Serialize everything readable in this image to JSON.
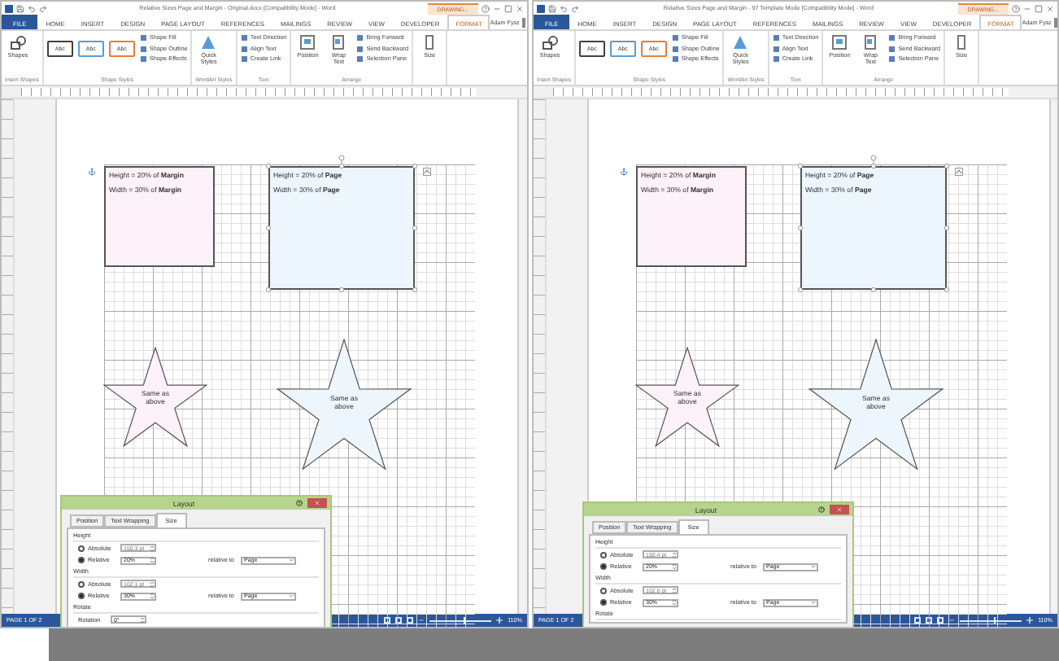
{
  "windows": [
    {
      "title_bar": {
        "title": "Relative Sizes Page and Margin - Original.docx [Compatibility Mode] - Word",
        "context_tab": "DRAWING..."
      },
      "menu_tabs": [
        {
          "label": "FILE",
          "kind": "file",
          "selected": false
        },
        {
          "label": "HOME",
          "kind": "tab",
          "selected": false
        },
        {
          "label": "INSERT",
          "kind": "tab",
          "selected": false
        },
        {
          "label": "DESIGN",
          "kind": "tab",
          "selected": false
        },
        {
          "label": "PAGE LAYOUT",
          "kind": "tab",
          "selected": false
        },
        {
          "label": "REFERENCES",
          "kind": "tab",
          "selected": false
        },
        {
          "label": "MAILINGS",
          "kind": "tab",
          "selected": false
        },
        {
          "label": "REVIEW",
          "kind": "tab",
          "selected": false
        },
        {
          "label": "VIEW",
          "kind": "tab",
          "selected": false
        },
        {
          "label": "DEVELOPER",
          "kind": "tab",
          "selected": false
        },
        {
          "label": "FORMAT",
          "kind": "context",
          "selected": true
        }
      ],
      "user": "Adam Fysz",
      "ribbon": [
        {
          "label": "Insert Shapes",
          "commands": [
            {
              "kind": "large",
              "label": "Shapes"
            }
          ]
        },
        {
          "label": "Shape Styles",
          "commands": [
            {
              "kind": "style",
              "label": "Abc",
              "color": "#404040"
            },
            {
              "kind": "style",
              "label": "Abc",
              "color": "#5b9bd5"
            },
            {
              "kind": "style",
              "label": "Abc",
              "color": "#ed7d31"
            },
            {
              "kind": "small",
              "label": "Shape Fill"
            },
            {
              "kind": "small",
              "label": "Shape Outline"
            },
            {
              "kind": "small",
              "label": "Shape Effects"
            }
          ]
        },
        {
          "label": "WordArt Styles",
          "commands": [
            {
              "kind": "large",
              "label": "Quick Styles"
            }
          ]
        },
        {
          "label": "Text",
          "commands": [
            {
              "kind": "small",
              "label": "Text Direction"
            },
            {
              "kind": "small",
              "label": "Align Text"
            },
            {
              "kind": "small",
              "label": "Create Link"
            }
          ]
        },
        {
          "label": "Arrange",
          "commands": [
            {
              "kind": "large",
              "label": "Position"
            },
            {
              "kind": "large",
              "label": "Wrap Text"
            },
            {
              "kind": "small",
              "label": "Bring Forward"
            },
            {
              "kind": "small",
              "label": "Send Backward"
            },
            {
              "kind": "small",
              "label": "Selection Pane"
            }
          ]
        },
        {
          "commands": [
            {
              "kind": "large",
              "label": "Size"
            }
          ]
        }
      ],
      "shapes": [
        {
          "kind": "rect",
          "color": "#fdf1fa",
          "selected": false,
          "lines": [
            "Height = 20% of **Margin**",
            "Width = 30% of **Margin**"
          ]
        },
        {
          "kind": "rect",
          "color": "#edf6fd",
          "selected": true,
          "lines": [
            "Height = 20% of **Page**",
            "Width = 30% of **Page**"
          ]
        },
        {
          "kind": "star",
          "color": "#fdf1fa",
          "text": "Same as above"
        },
        {
          "kind": "star",
          "color": "#edf6fd",
          "text": "Same as above"
        }
      ],
      "dialog": {
        "title": "Layout",
        "tabs": [
          {
            "label": "Position",
            "selected": false
          },
          {
            "label": "Text Wrapping",
            "selected": false
          },
          {
            "label": "Size",
            "selected": true
          }
        ],
        "sections": [
          {
            "heading": "Height",
            "rows": [
              {
                "kind": "radio",
                "label": "Absolute",
                "selected": false,
                "value": "150.3 pt"
              },
              {
                "kind": "radio",
                "label": "Relative",
                "selected": true,
                "value": "20%",
                "relative_label": "relative to",
                "relative_value": "Page"
              }
            ]
          },
          {
            "heading": "Width",
            "rows": [
              {
                "kind": "radio",
                "label": "Absolute",
                "selected": false,
                "value": "102.1 pt"
              },
              {
                "kind": "radio",
                "label": "Relative",
                "selected": true,
                "value": "30%",
                "relative_label": "relative to",
                "relative_value": "Page"
              }
            ]
          },
          {
            "heading": "Rotate",
            "rows": [
              {
                "kind": "spinner",
                "label": "Rotation",
                "value": "0°"
              }
            ]
          }
        ]
      },
      "status_bar": {
        "page": "PAGE 1 OF 2",
        "zoom_slider": {
          "level": 0.55
        },
        "zoom": "110%"
      }
    },
    {
      "title_bar": {
        "title": "Relative Sizes Page and Margin - 97 Template Mode [Compatibility Mode] - Word",
        "context_tab": "DRAWING..."
      },
      "menu_tabs": [
        {
          "label": "FILE",
          "kind": "file",
          "selected": false
        },
        {
          "label": "HOME",
          "kind": "tab",
          "selected": false
        },
        {
          "label": "INSERT",
          "kind": "tab",
          "selected": false
        },
        {
          "label": "DESIGN",
          "kind": "tab",
          "selected": false
        },
        {
          "label": "PAGE LAYOUT",
          "kind": "tab",
          "selected": false
        },
        {
          "label": "REFERENCES",
          "kind": "tab",
          "selected": false
        },
        {
          "label": "MAILINGS",
          "kind": "tab",
          "selected": false
        },
        {
          "label": "REVIEW",
          "kind": "tab",
          "selected": false
        },
        {
          "label": "VIEW",
          "kind": "tab",
          "selected": false
        },
        {
          "label": "DEVELOPER",
          "kind": "tab",
          "selected": false
        },
        {
          "label": "FORMAT",
          "kind": "context",
          "selected": true
        }
      ],
      "user": "Adam Fysz",
      "ribbon": [
        {
          "label": "Insert Shapes",
          "commands": [
            {
              "kind": "large",
              "label": "Shapes"
            }
          ]
        },
        {
          "label": "Shape Styles",
          "commands": [
            {
              "kind": "style",
              "label": "Abc",
              "color": "#404040"
            },
            {
              "kind": "style",
              "label": "Abc",
              "color": "#5b9bd5"
            },
            {
              "kind": "style",
              "label": "Abc",
              "color": "#ed7d31"
            },
            {
              "kind": "small",
              "label": "Shape Fill"
            },
            {
              "kind": "small",
              "label": "Shape Outline"
            },
            {
              "kind": "small",
              "label": "Shape Effects"
            }
          ]
        },
        {
          "label": "WordArt Styles",
          "commands": [
            {
              "kind": "large",
              "label": "Quick Styles"
            }
          ]
        },
        {
          "label": "Text",
          "commands": [
            {
              "kind": "small",
              "label": "Text Direction"
            },
            {
              "kind": "small",
              "label": "Align Text"
            },
            {
              "kind": "small",
              "label": "Create Link"
            }
          ]
        },
        {
          "label": "Arrange",
          "commands": [
            {
              "kind": "large",
              "label": "Position"
            },
            {
              "kind": "large",
              "label": "Wrap Text"
            },
            {
              "kind": "small",
              "label": "Bring Forward"
            },
            {
              "kind": "small",
              "label": "Send Backward"
            },
            {
              "kind": "small",
              "label": "Selection Pane"
            }
          ]
        },
        {
          "commands": [
            {
              "kind": "large",
              "label": "Size"
            }
          ]
        }
      ],
      "shapes": [
        {
          "kind": "rect",
          "color": "#fdf1fa",
          "selected": false,
          "lines": [
            "Height = 20% of **Margin**",
            "Width = 30% of **Margin**"
          ]
        },
        {
          "kind": "rect",
          "color": "#edf6fd",
          "selected": true,
          "lines": [
            "Height = 20% of **Page**",
            "Width = 30% of **Page**"
          ]
        },
        {
          "kind": "star",
          "color": "#fdf1fa",
          "text": "Same as above"
        },
        {
          "kind": "star",
          "color": "#edf6fd",
          "text": "Same as above"
        }
      ],
      "dialog": {
        "title": "Layout",
        "tabs": [
          {
            "label": "Position",
            "selected": false
          },
          {
            "label": "Text Wrapping",
            "selected": false
          },
          {
            "label": "Size",
            "selected": true
          }
        ],
        "sections": [
          {
            "heading": "Height",
            "rows": [
              {
                "kind": "radio",
                "label": "Absolute",
                "selected": false,
                "value": "150.4 pt"
              },
              {
                "kind": "radio",
                "label": "Relative",
                "selected": true,
                "value": "20%",
                "relative_label": "relative to",
                "relative_value": "Page"
              }
            ]
          },
          {
            "heading": "Width",
            "rows": [
              {
                "kind": "radio",
                "label": "Absolute",
                "selected": false,
                "value": "102.6 pt"
              },
              {
                "kind": "radio",
                "label": "Relative",
                "selected": true,
                "value": "30%",
                "relative_label": "relative to",
                "relative_value": "Page"
              }
            ]
          },
          {
            "heading": "Rotate"
          }
        ]
      },
      "status_bar": {
        "page": "PAGE 1 OF 2",
        "zoom_slider": {
          "level": 0.55
        },
        "zoom": "110%"
      }
    }
  ]
}
